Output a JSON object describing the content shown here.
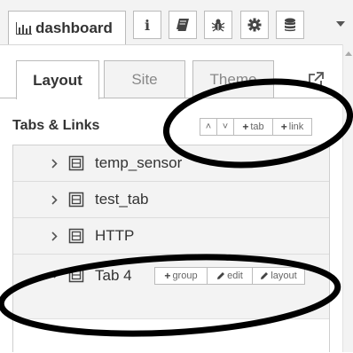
{
  "toolbar": {
    "dashboard_tab_label": "dashboard",
    "buttons": [
      {
        "icon": "info-icon",
        "glyph": "i"
      },
      {
        "icon": "book-icon"
      },
      {
        "icon": "bug-icon"
      },
      {
        "icon": "gear-icon"
      },
      {
        "icon": "database-icon"
      }
    ]
  },
  "sub_tabs": {
    "layout": "Layout",
    "site": "Site",
    "theme": "Theme",
    "active": "Layout"
  },
  "section": {
    "title": "Tabs & Links",
    "buttons": {
      "expand_all": "˄",
      "collapse_all": "˅",
      "add_tab": "tab",
      "add_link": "link"
    }
  },
  "tree": {
    "rows": [
      {
        "label": "temp_sensor",
        "expanded": false
      },
      {
        "label": "test_tab",
        "expanded": false
      },
      {
        "label": "HTTP",
        "expanded": false
      },
      {
        "label": "Tab 4",
        "expanded": true
      }
    ],
    "row_buttons": {
      "group": "group",
      "edit": "edit",
      "layout": "layout"
    }
  },
  "colors": {
    "annotation_stroke": "#000000",
    "toolbar_bg": "#f3f3f3",
    "tree_bg": "#f3f3f3"
  }
}
